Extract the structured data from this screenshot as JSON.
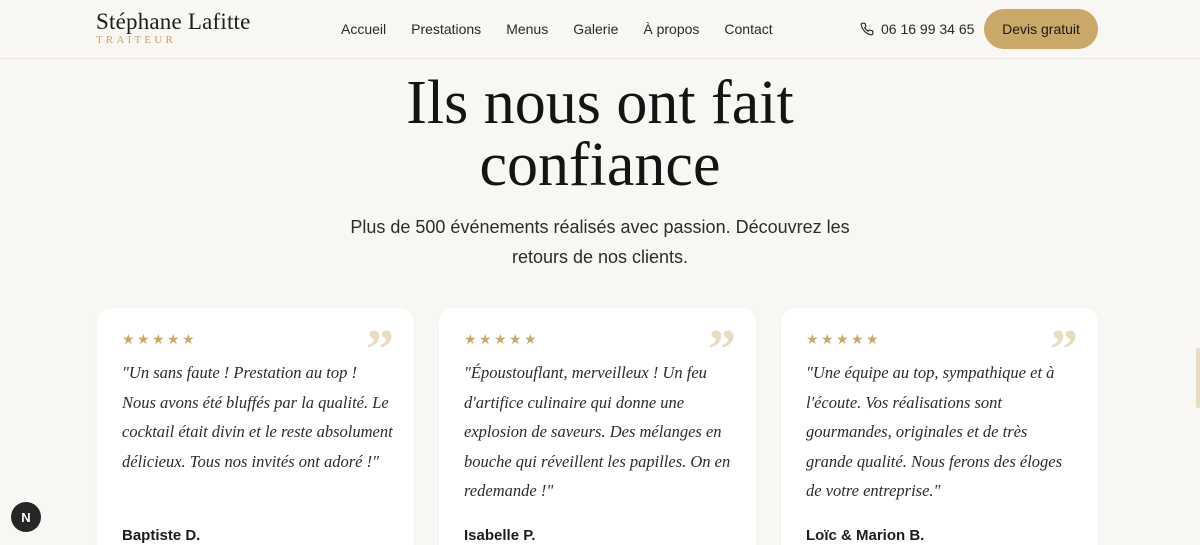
{
  "header": {
    "logo_name": "Stéphane Lafitte",
    "logo_sub": "TRAITEUR",
    "nav": [
      "Accueil",
      "Prestations",
      "Menus",
      "Galerie",
      "À propos",
      "Contact"
    ],
    "phone": "06 16 99 34 65",
    "phone_icon": "phone-icon",
    "cta": "Devis gratuit"
  },
  "hero": {
    "title": "Ils nous ont fait confiance",
    "subtitle": "Plus de 500 événements réalisés avec passion. Découvrez les retours de nos clients."
  },
  "testimonials": [
    {
      "stars": 5,
      "quote": "\"Un sans faute ! Prestation au top ! Nous avons été bluffés par la qualité. Le cocktail était divin et le reste absolument délicieux. Tous nos invités ont adoré !\"",
      "author": "Baptiste D."
    },
    {
      "stars": 5,
      "quote": "\"Époustouflant, merveilleux ! Un feu d'artifice culinaire qui donne une explosion de saveurs. Des mélanges en bouche qui réveillent les papilles. On en redemande !\"",
      "author": "Isabelle P."
    },
    {
      "stars": 5,
      "quote": "\"Une équipe au top, sympathique et à l'écoute. Vos réalisations sont gourmandes, originales et de très grande qualité. Nous ferons des éloges de votre entreprise.\"",
      "author": "Loïc & Marion B."
    }
  ],
  "badge": "N",
  "colors": {
    "accent": "#c9a86a",
    "background": "#f9f7f3",
    "card": "#ffffff",
    "quote_mark": "#e8dcc3"
  }
}
